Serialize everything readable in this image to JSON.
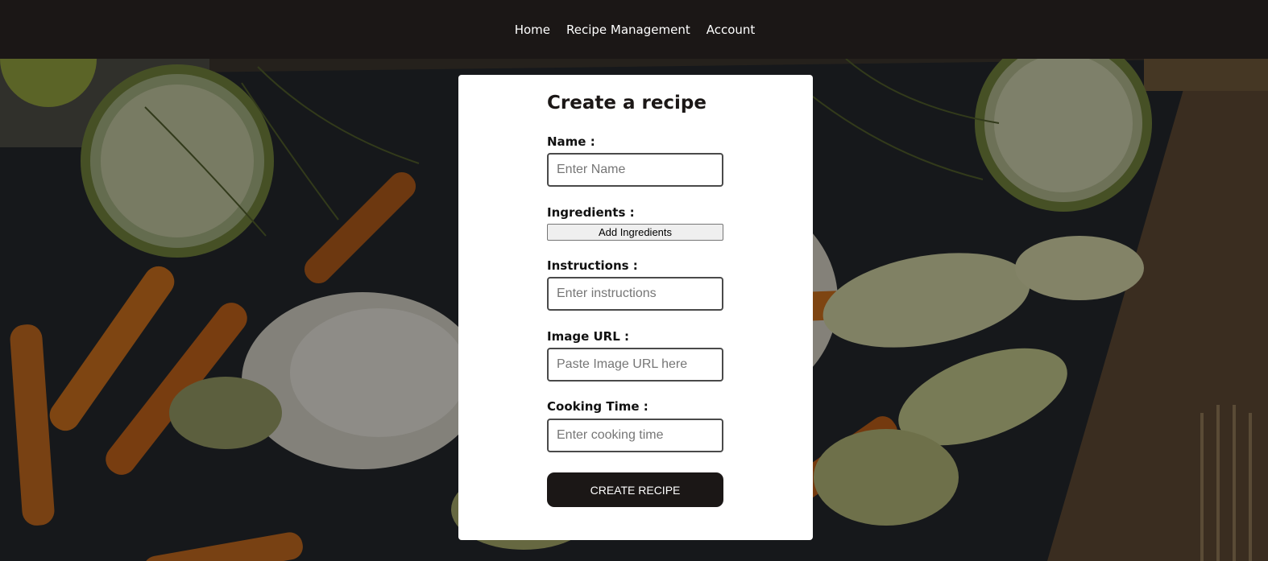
{
  "nav": {
    "links": [
      {
        "label": "Home"
      },
      {
        "label": "Recipe Management"
      },
      {
        "label": "Account"
      }
    ]
  },
  "form": {
    "title": "Create a recipe",
    "name": {
      "label": "Name :",
      "placeholder": "Enter Name"
    },
    "ingredients": {
      "label": "Ingredients :",
      "button": "Add Ingredients"
    },
    "instructions": {
      "label": "Instructions :",
      "placeholder": "Enter instructions"
    },
    "image_url": {
      "label": "Image URL :",
      "placeholder": "Paste Image URL here"
    },
    "cooking_time": {
      "label": "Cooking Time :",
      "placeholder": "Enter cooking time"
    },
    "submit": "CREATE RECIPE"
  },
  "colors": {
    "navbar": "#1b1716",
    "button": "#1b1716",
    "card": "#ffffff"
  }
}
